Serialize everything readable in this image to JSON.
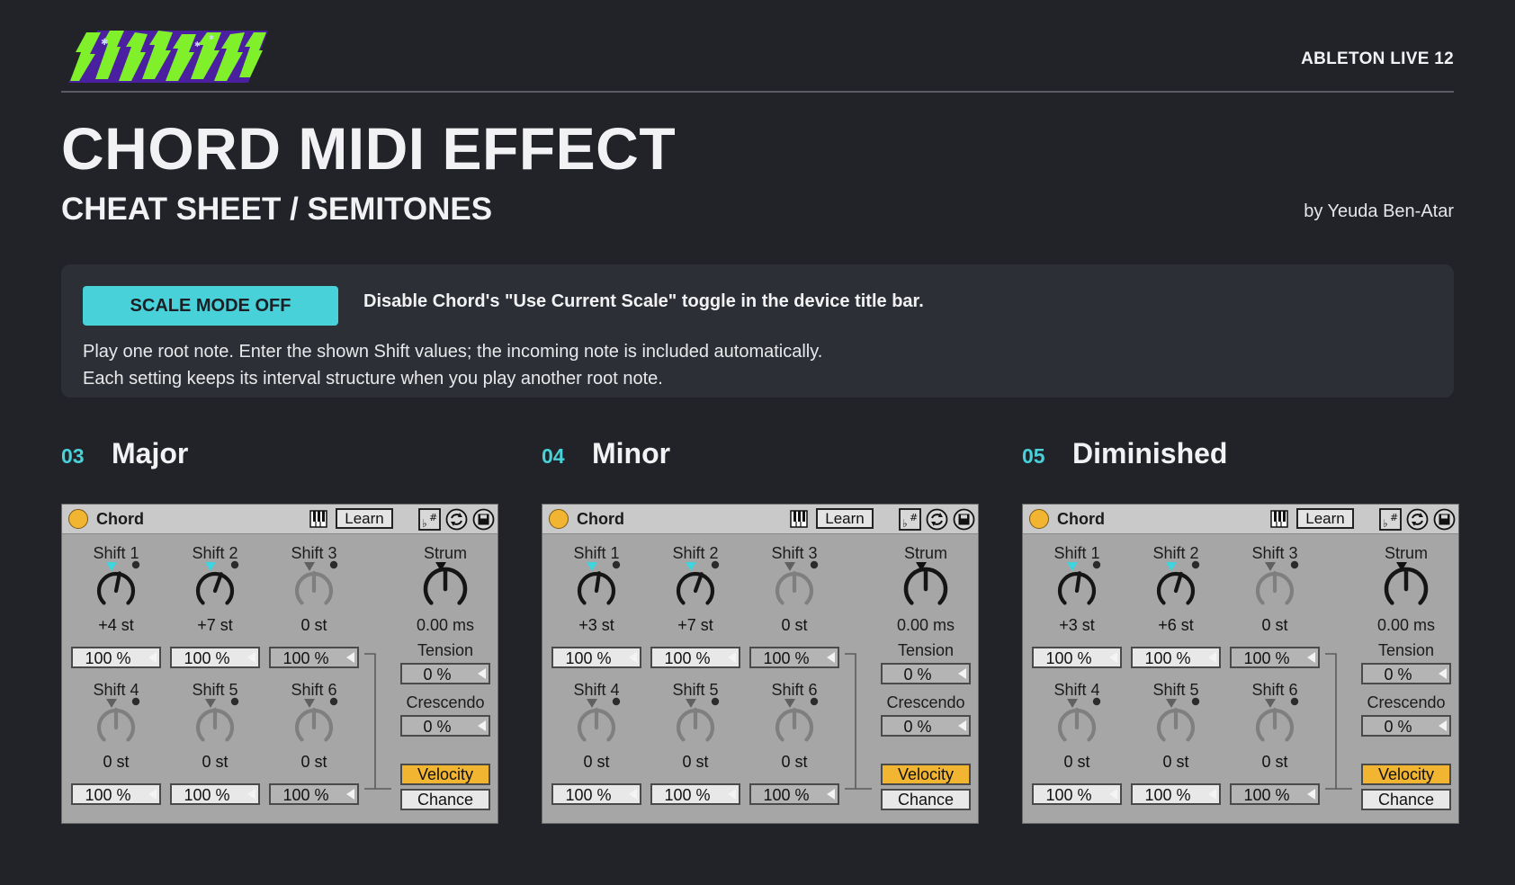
{
  "header": {
    "logo_text": "SUPERBANK",
    "app_name": "ABLETON LIVE 12",
    "title": "CHORD MIDI EFFECT",
    "subtitle": "CHEAT SHEET / SEMITONES",
    "author": "by Yeuda Ben-Atar"
  },
  "info": {
    "mode_badge": "SCALE MODE OFF",
    "mode_description": "Disable Chord's \"Use Current Scale\" toggle in the device title bar.",
    "line1": "Play one root note. Enter the shown Shift values; the incoming note is included automatically.",
    "line2": "Each setting keeps its interval structure when you play another root note."
  },
  "colors": {
    "accent": "#48d1d8",
    "device_power": "#f2b532",
    "velocity_on": "#f2b532",
    "background": "#212328"
  },
  "device_labels": {
    "name": "Chord",
    "learn": "Learn",
    "strum": "Strum",
    "tension": "Tension",
    "crescendo": "Crescendo",
    "velocity": "Velocity",
    "chance": "Chance",
    "shift_labels": [
      "Shift 1",
      "Shift 2",
      "Shift 3",
      "Shift 4",
      "Shift 5",
      "Shift 6"
    ]
  },
  "sections": [
    {
      "number": "03",
      "name": "Major",
      "shifts": [
        "+4 st",
        "+7 st",
        "0 st",
        "0 st",
        "0 st",
        "0 st"
      ],
      "shift_semitones": [
        4,
        7,
        0,
        0,
        0,
        0
      ],
      "velocities": [
        "100 %",
        "100 %",
        "100 %",
        "100 %",
        "100 %",
        "100 %"
      ],
      "strum": "0.00 ms",
      "tension": "0 %",
      "crescendo": "0 %"
    },
    {
      "number": "04",
      "name": "Minor",
      "shifts": [
        "+3 st",
        "+7 st",
        "0 st",
        "0 st",
        "0 st",
        "0 st"
      ],
      "shift_semitones": [
        3,
        7,
        0,
        0,
        0,
        0
      ],
      "velocities": [
        "100 %",
        "100 %",
        "100 %",
        "100 %",
        "100 %",
        "100 %"
      ],
      "strum": "0.00 ms",
      "tension": "0 %",
      "crescendo": "0 %"
    },
    {
      "number": "05",
      "name": "Diminished",
      "shifts": [
        "+3 st",
        "+6 st",
        "0 st",
        "0 st",
        "0 st",
        "0 st"
      ],
      "shift_semitones": [
        3,
        6,
        0,
        0,
        0,
        0
      ],
      "velocities": [
        "100 %",
        "100 %",
        "100 %",
        "100 %",
        "100 %",
        "100 %"
      ],
      "strum": "0.00 ms",
      "tension": "0 %",
      "crescendo": "0 %"
    }
  ],
  "icons": [
    "piano-keys-icon",
    "scale-sharp-flat-icon",
    "hot-swap-icon",
    "save-preset-icon",
    "power-icon"
  ]
}
